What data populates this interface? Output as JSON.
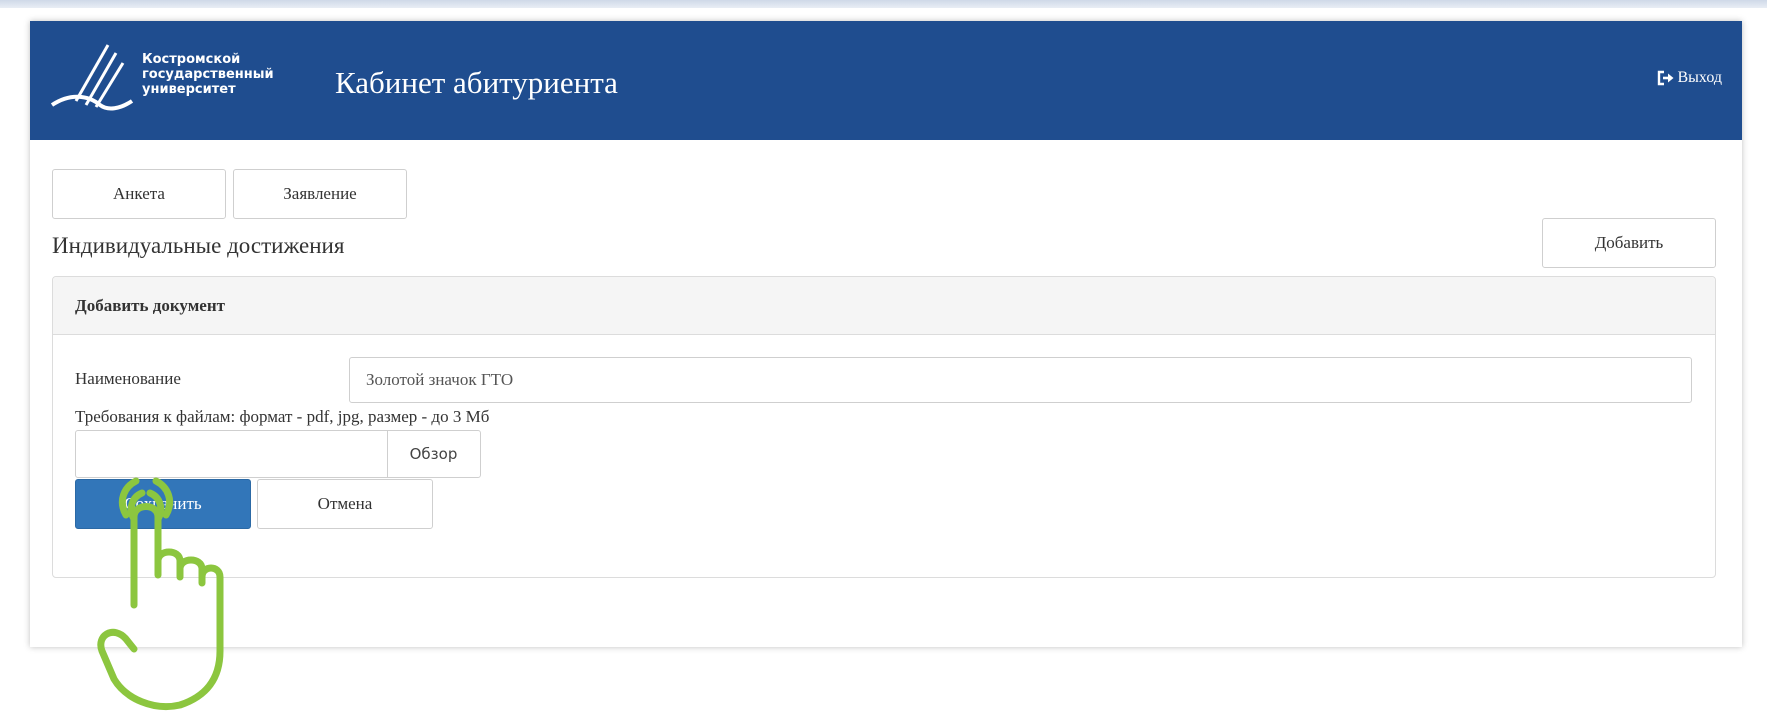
{
  "header": {
    "logo_lines": [
      "Костромской",
      "государственный",
      "университет"
    ],
    "title": "Кабинет абитуриента",
    "logout_label": "Выход",
    "logout_icon": "logout-icon",
    "background_color": "#1f4d8f"
  },
  "tabs": [
    {
      "label": "Анкета"
    },
    {
      "label": "Заявление"
    }
  ],
  "section": {
    "title": "Индивидуальные достижения",
    "add_button_label": "Добавить"
  },
  "panel": {
    "title": "Добавить документ",
    "name_label": "Наименование",
    "name_value": "Золотой значок ГТО",
    "requirements": "Требования к файлам: формат - pdf, jpg, размер - до 3 Мб",
    "file_value": "",
    "browse_label": "Обзор",
    "save_label": "Сохранить",
    "cancel_label": "Отмена",
    "save_color": "#3276b9"
  },
  "overlay": {
    "pointer_icon": "tap-hand-icon",
    "pointer_color": "#8cc63f"
  }
}
